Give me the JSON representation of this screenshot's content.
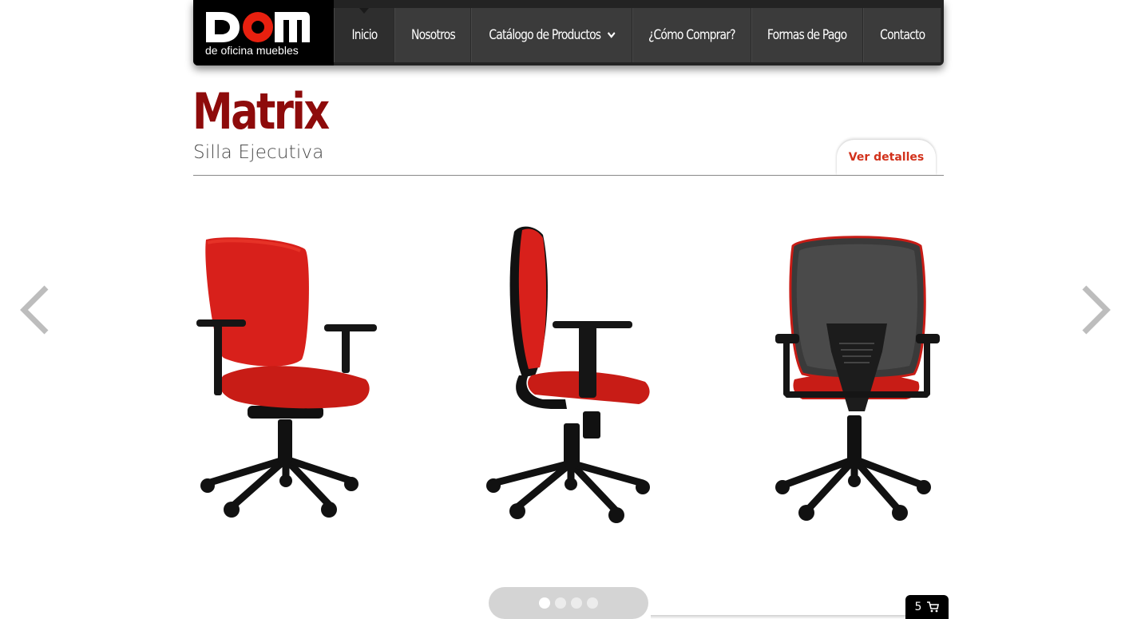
{
  "brand": {
    "logo_text": "DOM",
    "tagline": "de oficina muebles",
    "accent_color": "#e8200f"
  },
  "nav": {
    "items": [
      {
        "label": "Inicio",
        "active": true
      },
      {
        "label": "Nosotros"
      },
      {
        "label": "Catálogo de Productos",
        "has_dropdown": true,
        "icon": "chevron-down-icon"
      },
      {
        "label": "¿Cómo Comprar?"
      },
      {
        "label": "Formas de Pago"
      },
      {
        "label": "Contacto"
      }
    ]
  },
  "product": {
    "title": "Matrix",
    "subtitle": "Silla Ejecutiva",
    "details_button": "Ver detalles",
    "title_color": "#8e0b0b",
    "button_text_color": "#d2311b"
  },
  "carousel": {
    "images": [
      {
        "name": "chair-front-view"
      },
      {
        "name": "chair-side-view"
      },
      {
        "name": "chair-back-view"
      }
    ],
    "page_count": 4,
    "current_page": 1,
    "prev_icon": "chevron-left-icon",
    "next_icon": "chevron-right-icon"
  },
  "cart": {
    "count": "5",
    "icon": "cart-icon"
  }
}
